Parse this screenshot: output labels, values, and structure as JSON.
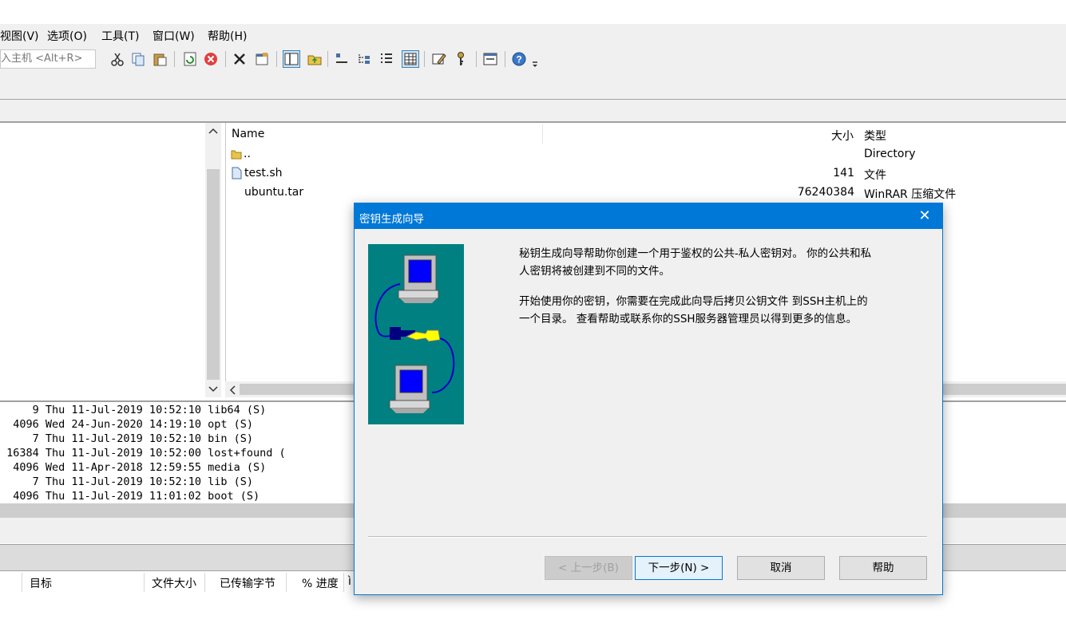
{
  "menu": [
    "视图(V)",
    "选项(O)",
    "工具(T)",
    "窗口(W)",
    "帮助(H)"
  ],
  "toolbar": {
    "host_placeholder": "入主机 <Alt+R>"
  },
  "file_list": {
    "columns": {
      "name": "Name",
      "size": "大小",
      "type": "类型"
    },
    "rows": [
      {
        "name": "..",
        "size": "",
        "type": "Directory",
        "icon": "folder-icon"
      },
      {
        "name": "test.sh",
        "size": "141",
        "type": "文件",
        "icon": "file-icon"
      },
      {
        "name": "ubuntu.tar",
        "size": "76240384",
        "type": "WinRAR 压缩文件",
        "icon": ""
      }
    ]
  },
  "log": [
    "     9 Thu 11-Jul-2019 10:52:10 lib64 (S)",
    "  4096 Wed 24-Jun-2020 14:19:10 opt (S)",
    "     7 Thu 11-Jul-2019 10:52:10 bin (S)",
    " 16384 Thu 11-Jul-2019 10:52:00 lost+found (",
    "  4096 Wed 11-Apr-2018 12:59:55 media (S)",
    "     7 Thu 11-Jul-2019 10:52:10 lib (S)",
    "  4096 Thu 11-Jul-2019 11:01:02 boot (S)"
  ],
  "queue_header": {
    "target": "目标",
    "file_size": "文件大小",
    "transferred": "已传输字节",
    "progress": "% 进度",
    "extra": "ì"
  },
  "dialog": {
    "title": "密钥生成向导",
    "close": "✕",
    "para1_line1": "秘钥生成向导帮助你创建一个用于鉴权的公共-私人密钥对。 你的公共和私",
    "para1_line2": "人密钥将被创建到不同的文件。",
    "para2_line1": "开始使用你的密钥，你需要在完成此向导后拷贝公钥文件 到SSH主机上的",
    "para2_line2": "一个目录。 查看帮助或联系你的SSH服务器管理员以得到更多的信息。",
    "buttons": {
      "back": "< 上一步(B)",
      "next": "下一步(N) >",
      "cancel": "取消",
      "help": "帮助"
    }
  },
  "colors": {
    "accent": "#0078d7",
    "teal": "#008080"
  }
}
